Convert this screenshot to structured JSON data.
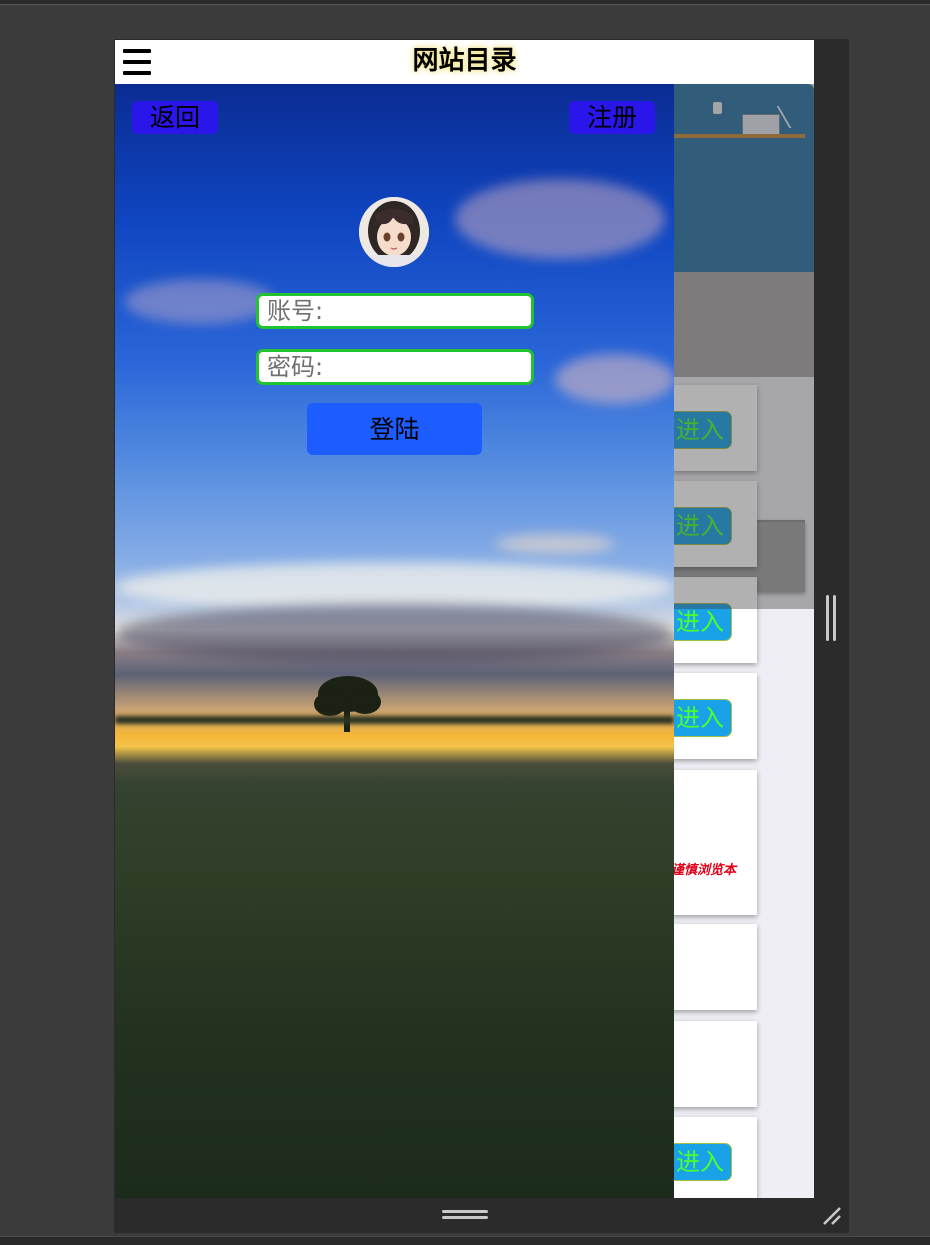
{
  "header": {
    "title": "网站目录"
  },
  "drawer": {
    "back_label": "返回",
    "register_label": "注册",
    "account_placeholder": "账号:",
    "password_placeholder": "密码:",
    "login_label": "登陆"
  },
  "background_page": {
    "enter_label": "进入",
    "warning_text": "谨慎浏览本"
  },
  "colors": {
    "accent_blue": "#1d5cff",
    "nav_button": "#2a16ea",
    "field_border": "#22c331",
    "enter_text": "#4dff2e"
  }
}
